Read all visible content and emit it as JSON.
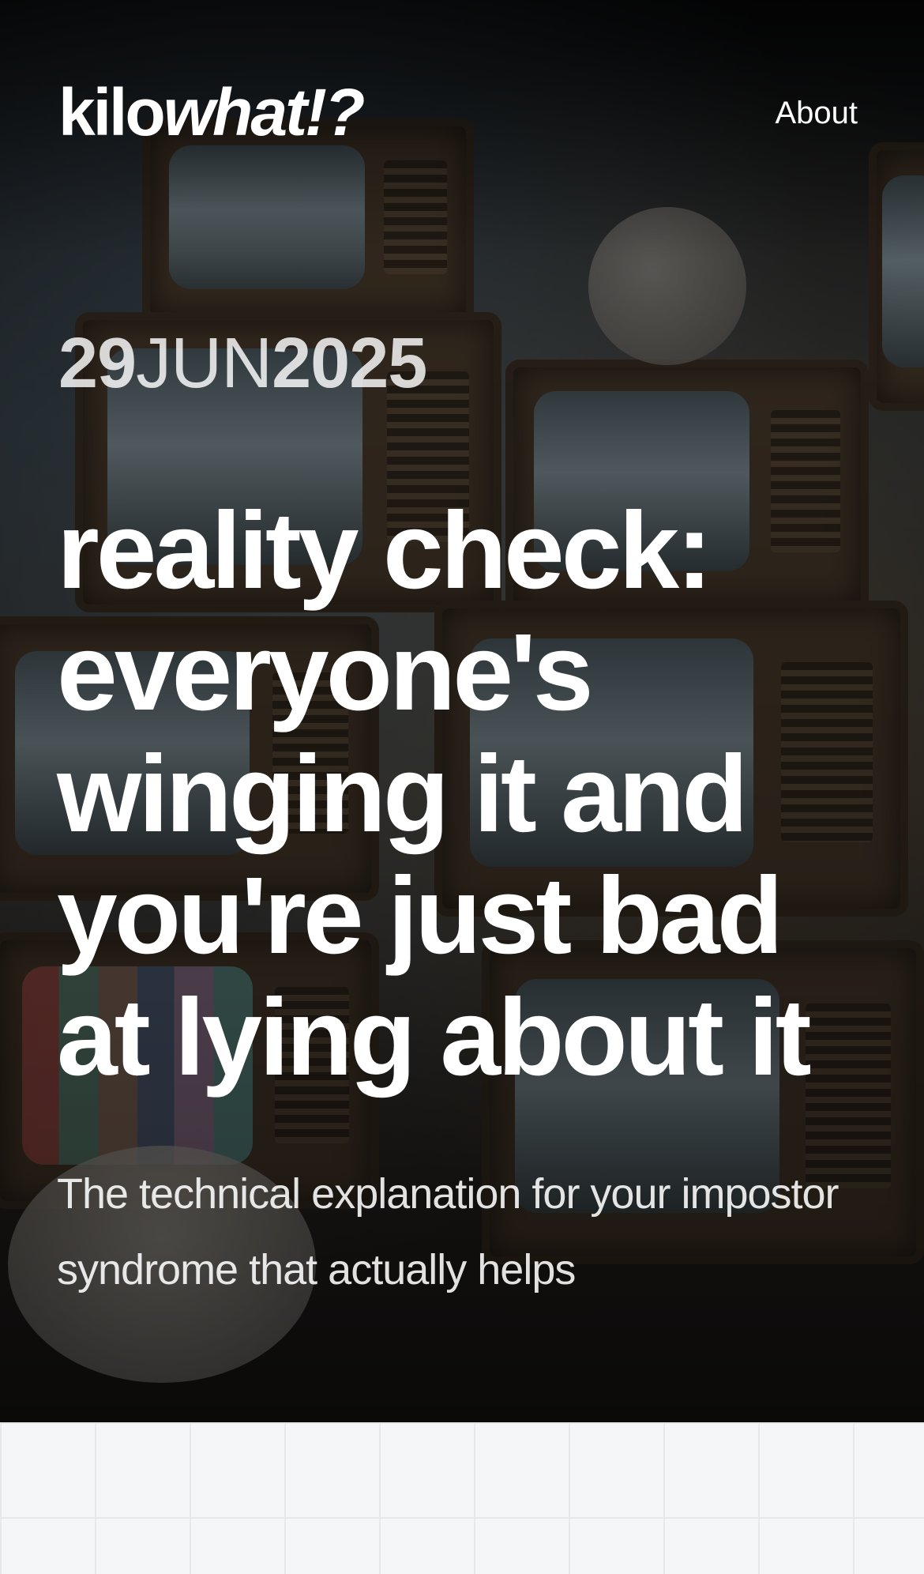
{
  "header": {
    "logo_part1": "kilo",
    "logo_part2": "what!?",
    "nav_about": "About"
  },
  "post": {
    "date_day": "29",
    "date_month": "JUN",
    "date_year": "2025",
    "title": "reality check: everyone's winging it and you're just bad at lying about it",
    "subtitle": "The technical explanation for your impostor syndrome that actually helps"
  }
}
